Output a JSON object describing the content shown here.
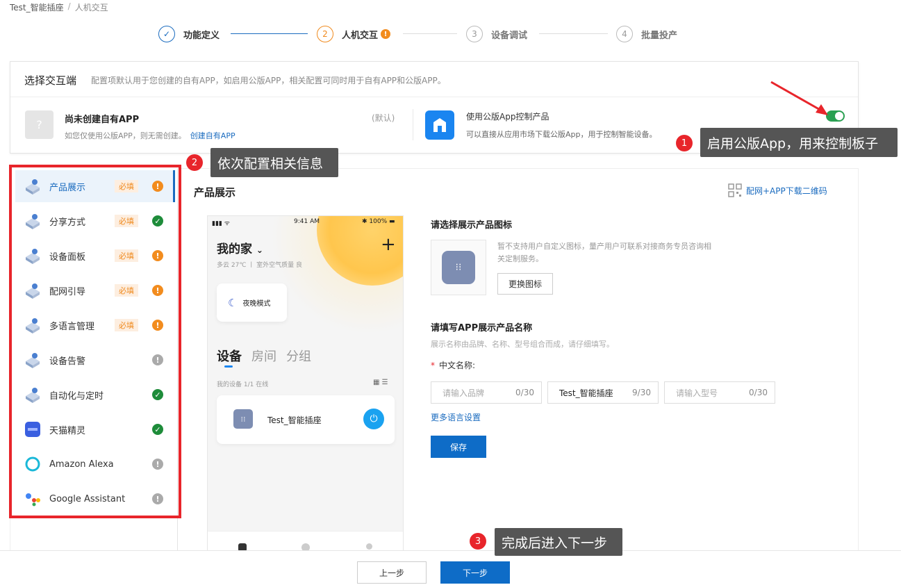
{
  "breadcrumb": {
    "project": "Test_智能插座",
    "separator": "/",
    "current": "人机交互"
  },
  "steps": [
    {
      "num": "✓",
      "label": "功能定义",
      "state": "done"
    },
    {
      "num": "2",
      "label": "人机交互",
      "state": "current"
    },
    {
      "num": "3",
      "label": "设备调试",
      "state": "todo"
    },
    {
      "num": "4",
      "label": "批量投产",
      "state": "todo"
    }
  ],
  "interaction": {
    "title": "选择交互端",
    "desc": "配置项默认用于您创建的自有APP，如启用公版APP，相关配置可同时用于自有APP和公版APP。",
    "own_app": {
      "icon_char": "?",
      "title": "尚未创建自有APP",
      "desc": "如您仅使用公版APP，则无需创建。",
      "create_link": "创建自有APP",
      "default_tag": "(默认)"
    },
    "public_app": {
      "title": "使用公版App控制产品",
      "desc": "可以直接从应用市场下载公版App，用于控制智能设备。",
      "enabled": true
    }
  },
  "callouts": [
    {
      "num": "1",
      "text": "启用公版App，用来控制板子"
    },
    {
      "num": "2",
      "text": "依次配置相关信息"
    },
    {
      "num": "3",
      "text": "完成后进入下一步"
    }
  ],
  "sidebar": {
    "items": [
      {
        "label": "产品展示",
        "required": "必填",
        "status": "!",
        "status_type": "warn"
      },
      {
        "label": "分享方式",
        "required": "必填",
        "status": "✓",
        "status_type": "ok"
      },
      {
        "label": "设备面板",
        "required": "必填",
        "status": "!",
        "status_type": "warn"
      },
      {
        "label": "配网引导",
        "required": "必填",
        "status": "!",
        "status_type": "warn"
      },
      {
        "label": "多语言管理",
        "required": "必填",
        "status": "!",
        "status_type": "warn"
      },
      {
        "label": "设备告警",
        "required": "",
        "status": "!",
        "status_type": "grey"
      },
      {
        "label": "自动化与定时",
        "required": "",
        "status": "✓",
        "status_type": "ok"
      },
      {
        "label": "天猫精灵",
        "required": "",
        "status": "✓",
        "status_type": "ok"
      },
      {
        "label": "Amazon Alexa",
        "required": "",
        "status": "!",
        "status_type": "grey"
      },
      {
        "label": "Google Assistant",
        "required": "",
        "status": "!",
        "status_type": "grey"
      }
    ]
  },
  "main": {
    "title": "产品展示",
    "qr_link": "配网+APP下载二维码",
    "phone": {
      "signal": "▮▮▮ ᯤ",
      "time": "9:41 AM",
      "battery": "✱ 100% ▬",
      "home": "我的家",
      "chevron": "⌄",
      "plus": "+",
      "weather": "多云 27℃  丨 室外空气质量 良",
      "night_mode": "夜晚模式",
      "moon": "☾",
      "tabs": [
        "设备",
        "房间",
        "分组"
      ],
      "my_devices": "我的设备   1/1 在线",
      "grid_icons": "▦  ☰",
      "device_name": "Test_智能插座",
      "plug_glyph": "⁝⁝",
      "power_glyph": "⏻"
    },
    "icon_section": {
      "title": "请选择展示产品图标",
      "note": "暂不支持用户自定义图标，量产用户可联系对接商务专员咨询相关定制服务。",
      "change_btn": "更换图标",
      "plug_glyph": "⁝⁝"
    },
    "name_section": {
      "title": "请填写APP展示产品名称",
      "desc": "展示名称由品牌、名称、型号组合而成，请仔细填写。",
      "cn_label": "中文名称:",
      "required_star": "*",
      "inputs": [
        {
          "placeholder": "请输入品牌",
          "value": "",
          "count": "0/30"
        },
        {
          "placeholder": "",
          "value": "Test_智能插座",
          "count": "9/30"
        },
        {
          "placeholder": "请输入型号",
          "value": "",
          "count": "0/30"
        }
      ],
      "more_lang": "更多语言设置",
      "save_btn": "保存"
    }
  },
  "footer": {
    "prev": "上一步",
    "next": "下一步"
  },
  "colors": {
    "primary": "#0e6cc7",
    "warn": "#f28c1e",
    "ok": "#1e8c3a",
    "callout_red": "#e8252b",
    "toggle_on": "#2aa052"
  }
}
